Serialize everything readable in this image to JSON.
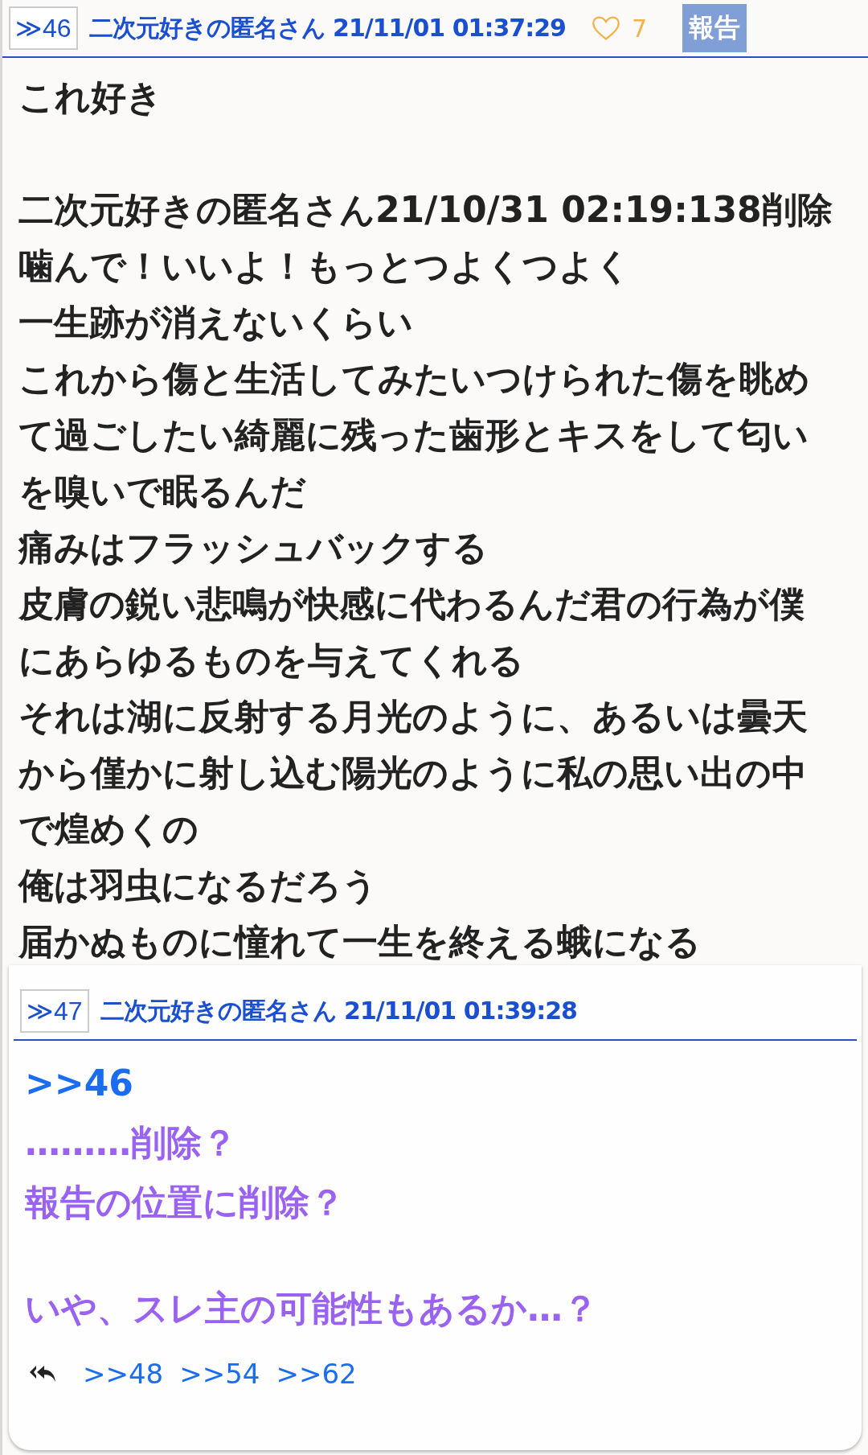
{
  "post": {
    "number": "≫46",
    "author_date": "二次元好きの匿名さん 21/11/01 01:37:29",
    "likes": "7",
    "liked": false,
    "report_button": "報告",
    "paragraphs": [
      {
        "lines": [
          "これ好き"
        ]
      },
      {
        "lines": [
          "二次元好きの匿名さん21/10/31 02:19:138削除",
          "噛んで！いいよ！もっとつよくつよく",
          "一生跡が消えないくらい",
          "これから傷と生活してみたいつけられた傷を眺め",
          "て過ごしたい綺麗に残った歯形とキスをして匂い",
          "を嗅いで眠るんだ",
          "痛みはフラッシュバックする",
          "皮膚の鋭い悲鳴が快感に代わるんだ君の行為が僕",
          "にあらゆるものを与えてくれる",
          "それは湖に反射する月光のように、あるいは曇天",
          "から僅かに射し込む陽光のように私の思い出の中",
          "で煌めくの",
          "俺は羽虫になるだろう",
          "届かぬものに憧れて一生を終える蛾になる"
        ]
      }
    ]
  },
  "popup": {
    "number": "≫47",
    "author_date": "二次元好きの匿名さん 21/11/01 01:39:28",
    "paragraphs": [
      {
        "lines": [
          {
            "kind": "anchor",
            "text": ">>46"
          },
          {
            "kind": "text",
            "text": "………削除？"
          },
          {
            "kind": "text",
            "text": "報告の位置に削除？"
          }
        ]
      },
      {
        "lines": [
          {
            "kind": "text",
            "text": "いや、スレ主の可能性もあるか…？"
          }
        ]
      }
    ],
    "replies": [
      ">>48",
      ">>54",
      ">>62"
    ]
  }
}
